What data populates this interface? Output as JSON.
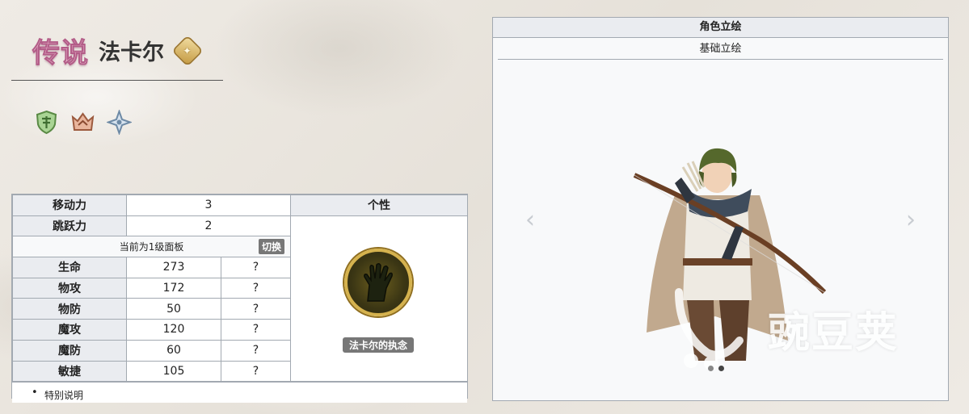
{
  "header": {
    "rarity": "传说",
    "name": "法卡尔",
    "emblem_icon": "compass-star-icon"
  },
  "class_icons": [
    "shield-crest-icon",
    "crown-icon",
    "star-cross-icon"
  ],
  "stats_table": {
    "move_label": "移动力",
    "move_value": "3",
    "jump_label": "跳跃力",
    "jump_value": "2",
    "trait_header": "个性",
    "level_text": "当前为1级面板",
    "switch_label": "切换",
    "rows": [
      {
        "label": "生命",
        "value": "273",
        "extra": "?"
      },
      {
        "label": "物攻",
        "value": "172",
        "extra": "?"
      },
      {
        "label": "物防",
        "value": "50",
        "extra": "?"
      },
      {
        "label": "魔攻",
        "value": "120",
        "extra": "?"
      },
      {
        "label": "魔防",
        "value": "60",
        "extra": "?"
      },
      {
        "label": "敏捷",
        "value": "105",
        "extra": "?"
      }
    ],
    "trait_name": "法卡尔的执念",
    "notes": "特别说明"
  },
  "portrait": {
    "title": "角色立绘",
    "tab": "基础立绘",
    "prev_arrow": "‹",
    "next_arrow": "›",
    "slide_count": 2,
    "active_slide": 1
  },
  "watermark": "豌豆荚",
  "colors": {
    "rarity_pink": "#f3c6d8",
    "table_header": "#eaecf0",
    "border": "#a2a9b1",
    "emblem_gold": "#c49a42"
  }
}
